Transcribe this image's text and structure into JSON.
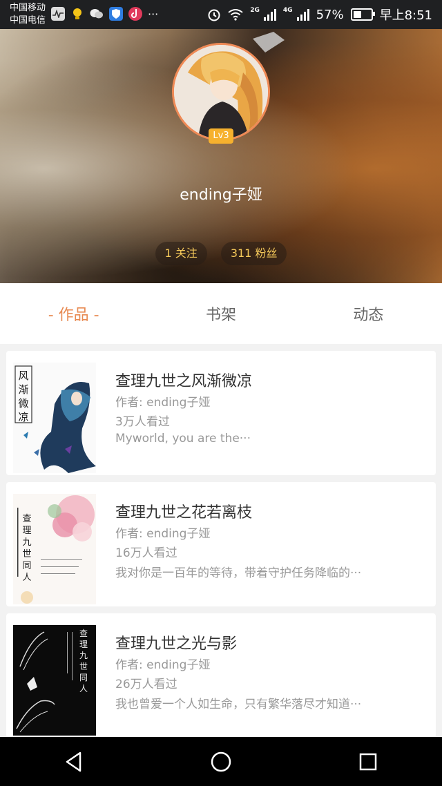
{
  "status_bar": {
    "carrier1": "中国移动",
    "carrier2": "中国电信",
    "app_icons": [
      "activity-icon",
      "bulb-icon",
      "wechat-icon",
      "shield-icon",
      "tiktok-icon",
      "more-dots-icon"
    ],
    "more": "···",
    "network_2g": "2G",
    "network_4g": "4G",
    "battery_percent": "57%",
    "battery_level": 0.57,
    "time": "早上8:51"
  },
  "profile": {
    "level_badge": "Lv3",
    "username": "ending子娅",
    "following": "1 关注",
    "followers": "311 粉丝"
  },
  "tabs": [
    {
      "label": "- 作品 -",
      "active": true
    },
    {
      "label": "书架",
      "active": false
    },
    {
      "label": "动态",
      "active": false
    }
  ],
  "books": [
    {
      "title": "查理九世之风渐微凉",
      "author": "作者: ending子娅",
      "views": "3万人看过",
      "description": "Myworld, you are the···",
      "cover_text": [
        "风",
        "渐",
        "微",
        "凉"
      ]
    },
    {
      "title": "查理九世之花若离枝",
      "author": "作者: ending子娅",
      "views": "16万人看过",
      "description": "我对你是一百年的等待，带着守护任务降临的···",
      "cover_text": [
        "查",
        "理",
        "九",
        "世",
        "同",
        "人"
      ]
    },
    {
      "title": "查理九世之光与影",
      "author": "作者: ending子娅",
      "views": "26万人看过",
      "description": "我也曾爱一个人如生命，只有繁华落尽才知道···",
      "cover_text": [
        "查",
        "理",
        "九",
        "世",
        "同",
        "人"
      ]
    }
  ],
  "colors": {
    "accent": "#e88a52",
    "badge": "#f6b12e",
    "pill_text": "#f4c85a"
  }
}
